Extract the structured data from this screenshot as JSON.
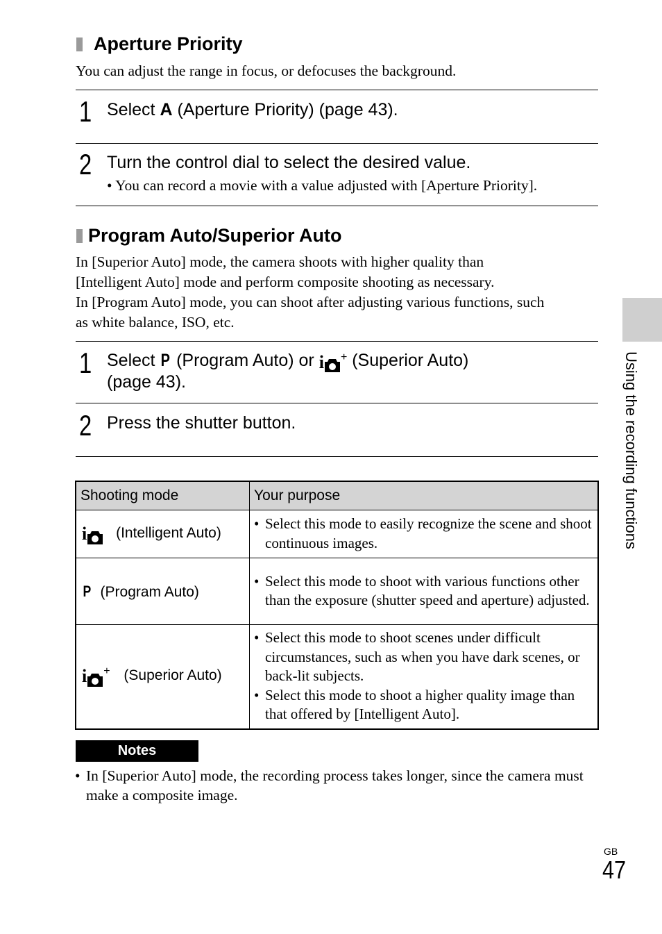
{
  "sections": {
    "aperture": {
      "heading": "Aperture Priority",
      "intro": "You can adjust the range in focus, or defocuses the background.",
      "steps": [
        {
          "number": "1",
          "text_before": "Select ",
          "mode_letter": "A",
          "text_after": " (Aperture Priority) (page 43)."
        },
        {
          "number": "2",
          "text": "Turn the control dial to select the desired value.",
          "bullet": "• You can record a movie with a value adjusted with [Aperture Priority]."
        }
      ]
    },
    "program": {
      "heading": "Program Auto/Superior Auto",
      "intro_lines": [
        "In [Superior Auto] mode, the camera shoots with higher quality than",
        "[Intelligent Auto] mode and perform composite shooting as necessary.",
        "In [Program Auto] mode, you can shoot after adjusting various functions, such",
        "as white balance, ISO, etc."
      ],
      "steps": [
        {
          "number": "1",
          "text_before": "Select ",
          "program_icon": "P",
          "text_mid": " (Program Auto) or ",
          "superior_icon_i": "i",
          "superior_icon_plus": "+",
          "text_after": " (Superior Auto)",
          "line2": "(page 43)."
        },
        {
          "number": "2",
          "text": "Press the shutter button."
        }
      ]
    }
  },
  "table": {
    "headers": [
      "Shooting mode",
      "Your purpose"
    ],
    "rows": [
      {
        "icon": "intelligent-auto-icon",
        "icon_i": "i",
        "icon_plus": "",
        "mode": "(Intelligent Auto)",
        "purposes": [
          "Select this mode to easily recognize the scene and shoot continuous images."
        ]
      },
      {
        "icon": "program-auto-icon",
        "icon_letter": "P",
        "mode": "(Program Auto)",
        "purposes": [
          "Select this mode to shoot with various functions other than the exposure (shutter speed and aperture) adjusted."
        ]
      },
      {
        "icon": "superior-auto-icon",
        "icon_i": "i",
        "icon_plus": "+",
        "mode": "(Superior Auto)",
        "purposes": [
          "Select this mode to shoot scenes under difficult circumstances, such as when you have dark scenes, or back-lit subjects.",
          "Select this mode to shoot a higher quality image than that offered by [Intelligent Auto]."
        ]
      }
    ]
  },
  "notes": {
    "label": "Notes",
    "items": [
      "In [Superior Auto] mode, the recording process takes longer, since the camera must make a composite image."
    ]
  },
  "side": {
    "chapter_label": "Using the recording functions",
    "tab_color": "#cfcfcf"
  },
  "footer": {
    "region": "GB",
    "page_number": "47"
  }
}
